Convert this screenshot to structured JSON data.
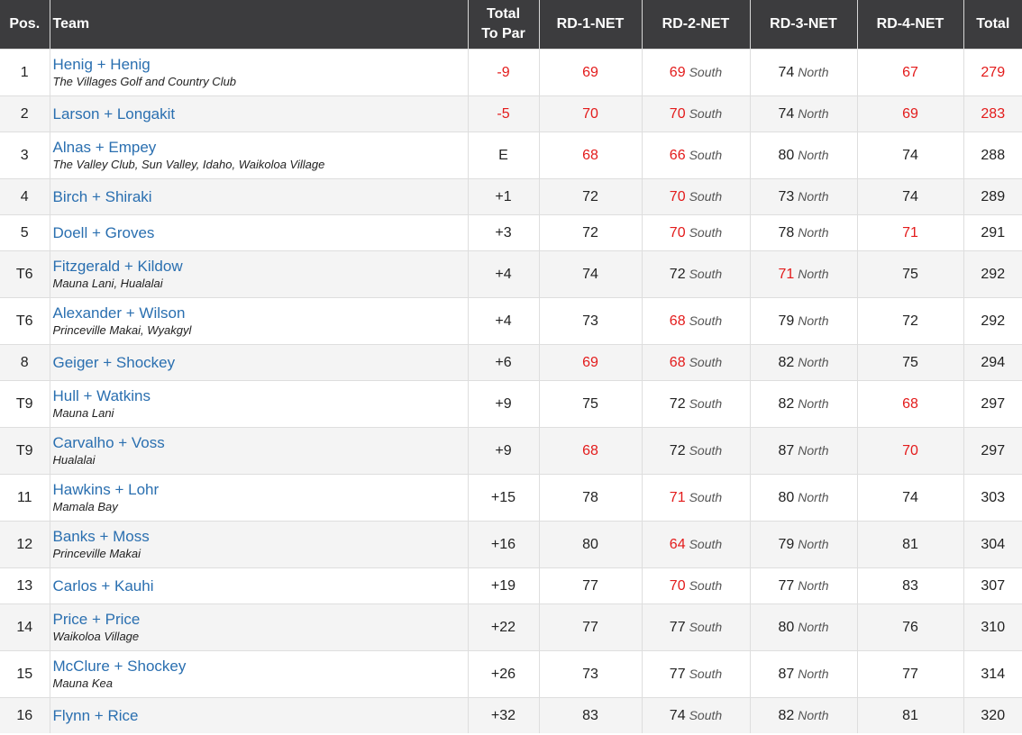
{
  "headers": {
    "pos": "Pos.",
    "team": "Team",
    "to_par_line1": "Total",
    "to_par_line2": "To Par",
    "rd1": "RD-1-NET",
    "rd2": "RD-2-NET",
    "rd3": "RD-3-NET",
    "rd4": "RD-4-NET",
    "total": "Total"
  },
  "colors": {
    "header_bg": "#3c3c3e",
    "link_blue": "#2a6fb0",
    "under_par_red": "#e31b1b",
    "row_alt": "#f4f4f4"
  },
  "rows": [
    {
      "pos": "1",
      "team": "Henig + Henig",
      "club": "The Villages Golf and Country Club",
      "to_par": "-9",
      "par_red": true,
      "r1": "69",
      "r1_red": true,
      "r2": "69",
      "r2_red": true,
      "r2_course": "South",
      "r3": "74",
      "r3_red": false,
      "r3_course": "North",
      "r4": "67",
      "r4_red": true,
      "total": "279",
      "total_red": true
    },
    {
      "pos": "2",
      "team": "Larson + Longakit",
      "club": "",
      "to_par": "-5",
      "par_red": true,
      "r1": "70",
      "r1_red": true,
      "r2": "70",
      "r2_red": true,
      "r2_course": "South",
      "r3": "74",
      "r3_red": false,
      "r3_course": "North",
      "r4": "69",
      "r4_red": true,
      "total": "283",
      "total_red": true
    },
    {
      "pos": "3",
      "team": "Alnas + Empey",
      "club": "The Valley Club, Sun Valley, Idaho, Waikoloa Village",
      "to_par": "E",
      "par_red": false,
      "r1": "68",
      "r1_red": true,
      "r2": "66",
      "r2_red": true,
      "r2_course": "South",
      "r3": "80",
      "r3_red": false,
      "r3_course": "North",
      "r4": "74",
      "r4_red": false,
      "total": "288",
      "total_red": false
    },
    {
      "pos": "4",
      "team": "Birch + Shiraki",
      "club": "",
      "to_par": "+1",
      "par_red": false,
      "r1": "72",
      "r1_red": false,
      "r2": "70",
      "r2_red": true,
      "r2_course": "South",
      "r3": "73",
      "r3_red": false,
      "r3_course": "North",
      "r4": "74",
      "r4_red": false,
      "total": "289",
      "total_red": false
    },
    {
      "pos": "5",
      "team": "Doell + Groves",
      "club": "",
      "to_par": "+3",
      "par_red": false,
      "r1": "72",
      "r1_red": false,
      "r2": "70",
      "r2_red": true,
      "r2_course": "South",
      "r3": "78",
      "r3_red": false,
      "r3_course": "North",
      "r4": "71",
      "r4_red": true,
      "total": "291",
      "total_red": false
    },
    {
      "pos": "T6",
      "team": "Fitzgerald + Kildow",
      "club": "Mauna Lani, Hualalai",
      "to_par": "+4",
      "par_red": false,
      "r1": "74",
      "r1_red": false,
      "r2": "72",
      "r2_red": false,
      "r2_course": "South",
      "r3": "71",
      "r3_red": true,
      "r3_course": "North",
      "r4": "75",
      "r4_red": false,
      "total": "292",
      "total_red": false
    },
    {
      "pos": "T6",
      "team": "Alexander + Wilson",
      "club": "Princeville Makai, Wyakgyl",
      "to_par": "+4",
      "par_red": false,
      "r1": "73",
      "r1_red": false,
      "r2": "68",
      "r2_red": true,
      "r2_course": "South",
      "r3": "79",
      "r3_red": false,
      "r3_course": "North",
      "r4": "72",
      "r4_red": false,
      "total": "292",
      "total_red": false
    },
    {
      "pos": "8",
      "team": "Geiger + Shockey",
      "club": "",
      "to_par": "+6",
      "par_red": false,
      "r1": "69",
      "r1_red": true,
      "r2": "68",
      "r2_red": true,
      "r2_course": "South",
      "r3": "82",
      "r3_red": false,
      "r3_course": "North",
      "r4": "75",
      "r4_red": false,
      "total": "294",
      "total_red": false
    },
    {
      "pos": "T9",
      "team": "Hull + Watkins",
      "club": "Mauna Lani",
      "to_par": "+9",
      "par_red": false,
      "r1": "75",
      "r1_red": false,
      "r2": "72",
      "r2_red": false,
      "r2_course": "South",
      "r3": "82",
      "r3_red": false,
      "r3_course": "North",
      "r4": "68",
      "r4_red": true,
      "total": "297",
      "total_red": false
    },
    {
      "pos": "T9",
      "team": "Carvalho + Voss",
      "club": "Hualalai",
      "to_par": "+9",
      "par_red": false,
      "r1": "68",
      "r1_red": true,
      "r2": "72",
      "r2_red": false,
      "r2_course": "South",
      "r3": "87",
      "r3_red": false,
      "r3_course": "North",
      "r4": "70",
      "r4_red": true,
      "total": "297",
      "total_red": false
    },
    {
      "pos": "11",
      "team": "Hawkins + Lohr",
      "club": "Mamala Bay",
      "to_par": "+15",
      "par_red": false,
      "r1": "78",
      "r1_red": false,
      "r2": "71",
      "r2_red": true,
      "r2_course": "South",
      "r3": "80",
      "r3_red": false,
      "r3_course": "North",
      "r4": "74",
      "r4_red": false,
      "total": "303",
      "total_red": false
    },
    {
      "pos": "12",
      "team": "Banks + Moss",
      "club": "Princeville Makai",
      "to_par": "+16",
      "par_red": false,
      "r1": "80",
      "r1_red": false,
      "r2": "64",
      "r2_red": true,
      "r2_course": "South",
      "r3": "79",
      "r3_red": false,
      "r3_course": "North",
      "r4": "81",
      "r4_red": false,
      "total": "304",
      "total_red": false
    },
    {
      "pos": "13",
      "team": "Carlos + Kauhi",
      "club": "",
      "to_par": "+19",
      "par_red": false,
      "r1": "77",
      "r1_red": false,
      "r2": "70",
      "r2_red": true,
      "r2_course": "South",
      "r3": "77",
      "r3_red": false,
      "r3_course": "North",
      "r4": "83",
      "r4_red": false,
      "total": "307",
      "total_red": false
    },
    {
      "pos": "14",
      "team": "Price + Price",
      "club": "Waikoloa Village",
      "to_par": "+22",
      "par_red": false,
      "r1": "77",
      "r1_red": false,
      "r2": "77",
      "r2_red": false,
      "r2_course": "South",
      "r3": "80",
      "r3_red": false,
      "r3_course": "North",
      "r4": "76",
      "r4_red": false,
      "total": "310",
      "total_red": false
    },
    {
      "pos": "15",
      "team": "McClure + Shockey",
      "club": "Mauna Kea",
      "to_par": "+26",
      "par_red": false,
      "r1": "73",
      "r1_red": false,
      "r2": "77",
      "r2_red": false,
      "r2_course": "South",
      "r3": "87",
      "r3_red": false,
      "r3_course": "North",
      "r4": "77",
      "r4_red": false,
      "total": "314",
      "total_red": false
    },
    {
      "pos": "16",
      "team": "Flynn + Rice",
      "club": "",
      "to_par": "+32",
      "par_red": false,
      "r1": "83",
      "r1_red": false,
      "r2": "74",
      "r2_red": false,
      "r2_course": "South",
      "r3": "82",
      "r3_red": false,
      "r3_course": "North",
      "r4": "81",
      "r4_red": false,
      "total": "320",
      "total_red": false
    }
  ]
}
